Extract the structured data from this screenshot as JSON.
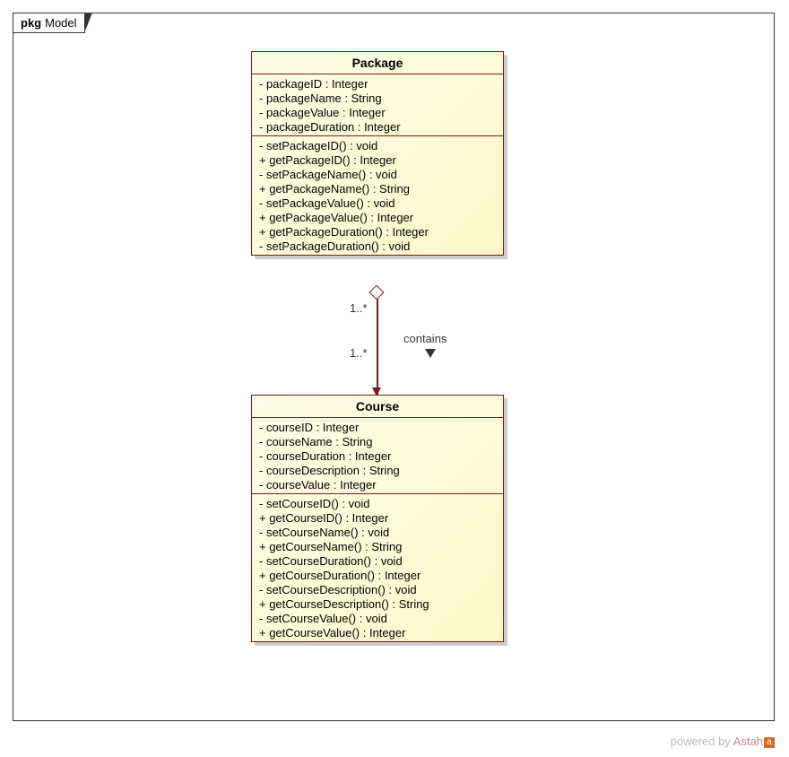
{
  "frame": {
    "prefix": "pkg",
    "name": "Model"
  },
  "package_class": {
    "name": "Package",
    "attributes": [
      "- packageID : Integer",
      "- packageName : String",
      "- packageValue : Integer",
      "- packageDuration : Integer"
    ],
    "operations": [
      "- setPackageID() : void",
      "+ getPackageID() : Integer",
      "- setPackageName() : void",
      "+ getPackageName() : String",
      "- setPackageValue() : void",
      "+ getPackageValue() : Integer",
      "+ getPackageDuration() : Integer",
      "- setPackageDuration() : void"
    ]
  },
  "course_class": {
    "name": "Course",
    "attributes": [
      "- courseID : Integer",
      "- courseName : String",
      "- courseDuration : Integer",
      "- courseDescription : String",
      "- courseValue : Integer"
    ],
    "operations": [
      "- setCourseID() : void",
      "+ getCourseID() : Integer",
      "- setCourseName() : void",
      "+ getCourseName() : String",
      "- setCourseDuration() : void",
      "+ getCourseDuration() : Integer",
      "- setCourseDescription() : void",
      "+ getCourseDescription() : String",
      "- setCourseValue() : void",
      "+ getCourseValue() : Integer"
    ]
  },
  "association": {
    "name": "contains",
    "mult_top": "1..*",
    "mult_bottom": "1..*"
  },
  "footer": {
    "text": "powered by ",
    "brand": "Astah",
    "suffix": "a"
  }
}
